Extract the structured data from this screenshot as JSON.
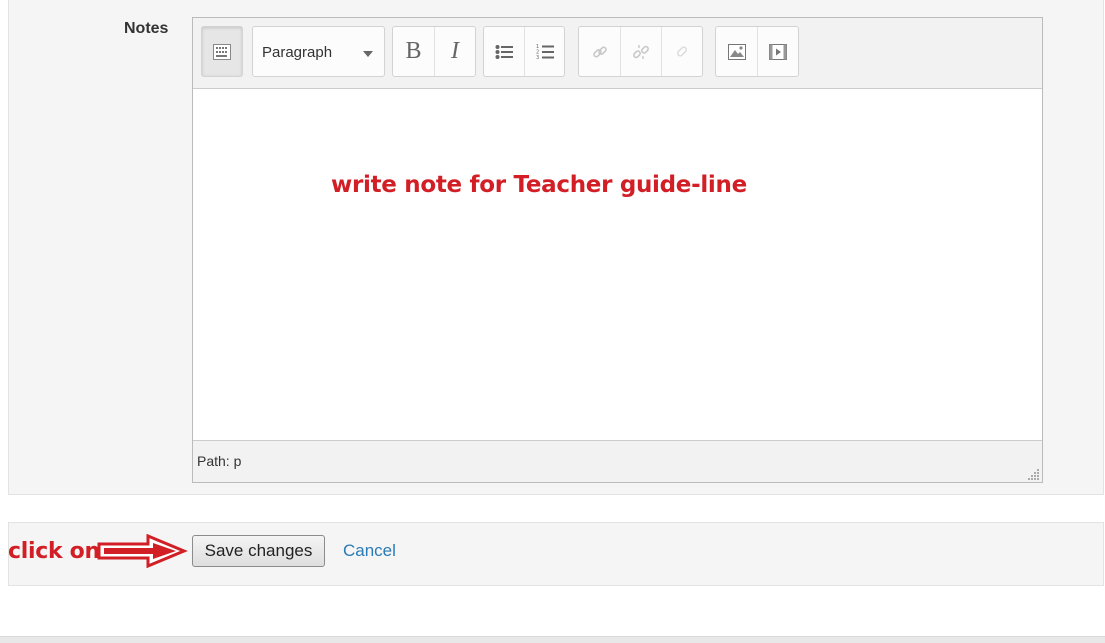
{
  "form": {
    "notes_label": "Notes"
  },
  "editor": {
    "toolbar": {
      "toggle_icon": "toolbar-toggle-icon",
      "format_value": "Paragraph",
      "bold_label": "B",
      "italic_label": "I",
      "unordered_list_icon": "unordered-list-icon",
      "ordered_list_icon": "ordered-list-icon",
      "link_icon": "link-icon",
      "unlink_icon": "unlink-icon",
      "anchor_icon": "anchor-icon",
      "image_icon": "image-icon",
      "media_icon": "media-icon"
    },
    "content_text": "write note for Teacher guide-line",
    "path_label": "Path: p"
  },
  "actions": {
    "annotation": "click on",
    "save_label": "Save changes",
    "cancel_label": "Cancel"
  },
  "colors": {
    "annotation_red": "#d21f26",
    "link_blue": "#2a7bb6",
    "panel_bg": "#f5f5f5"
  }
}
